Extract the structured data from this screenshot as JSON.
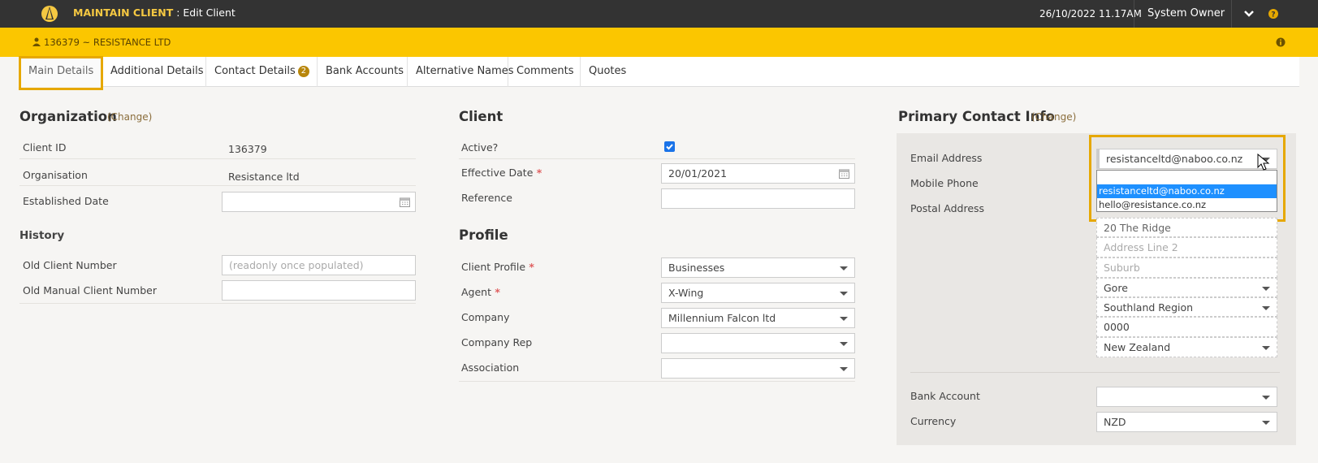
{
  "header": {
    "app_title_strong": "MAINTAIN CLIENT",
    "app_title_rest": " : Edit Client",
    "datetime": "26/10/2022 11.17AM",
    "user": "System Owner",
    "logo_icon": "sail-logo-icon",
    "dropdown_icon": "chevron-down-icon",
    "help_icon": "help-icon"
  },
  "client_bar": {
    "client": "136379 ~ RESISTANCE LTD",
    "person_icon": "person-icon",
    "info_icon": "info-icon"
  },
  "tabs": [
    {
      "label": "Main Details"
    },
    {
      "label": "Additional Details"
    },
    {
      "label": "Contact Details",
      "badge": "2"
    },
    {
      "label": "Bank Accounts"
    },
    {
      "label": "Alternative Names"
    },
    {
      "label": "Comments"
    },
    {
      "label": "Quotes"
    }
  ],
  "organization": {
    "title": "Organization",
    "change": "(Change)",
    "client_id_label": "Client ID",
    "client_id": "136379",
    "organisation_label": "Organisation",
    "organisation": "Resistance ltd",
    "established_label": "Established Date",
    "established": ""
  },
  "history": {
    "title": "History",
    "old_client_label": "Old Client Number",
    "old_client_placeholder": "(readonly once populated)",
    "old_manual_label": "Old Manual Client Number",
    "old_manual": ""
  },
  "client": {
    "title": "Client",
    "active_label": "Active?",
    "active": true,
    "effective_label": "Effective Date",
    "effective": "20/01/2021",
    "reference_label": "Reference",
    "reference": ""
  },
  "profile": {
    "title": "Profile",
    "client_profile_label": "Client Profile",
    "client_profile": "Businesses",
    "agent_label": "Agent",
    "agent": "X-Wing",
    "company_label": "Company",
    "company": "Millennium Falcon ltd",
    "company_rep_label": "Company Rep",
    "company_rep": "",
    "association_label": "Association",
    "association": ""
  },
  "primary_contact": {
    "title": "Primary Contact Info",
    "change": "(Change)",
    "email_label": "Email Address",
    "email": "resistanceltd@naboo.co.nz",
    "email_options": [
      "resistanceltd@naboo.co.nz",
      "hello@resistance.co.nz"
    ],
    "mobile_label": "Mobile Phone",
    "postal_label": "Postal Address",
    "address_line1": "20 The Ridge",
    "address_line2_placeholder": "Address Line 2",
    "suburb_placeholder": "Suburb",
    "city": "Gore",
    "region": "Southland Region",
    "postcode": "0000",
    "country": "New Zealand",
    "bank_label": "Bank Account",
    "bank": "",
    "currency_label": "Currency",
    "currency": "NZD"
  },
  "colors": {
    "topbar": "#333333",
    "clientbar": "#fbc600",
    "highlight": "#e6a800",
    "selected": "#1e90ff"
  }
}
